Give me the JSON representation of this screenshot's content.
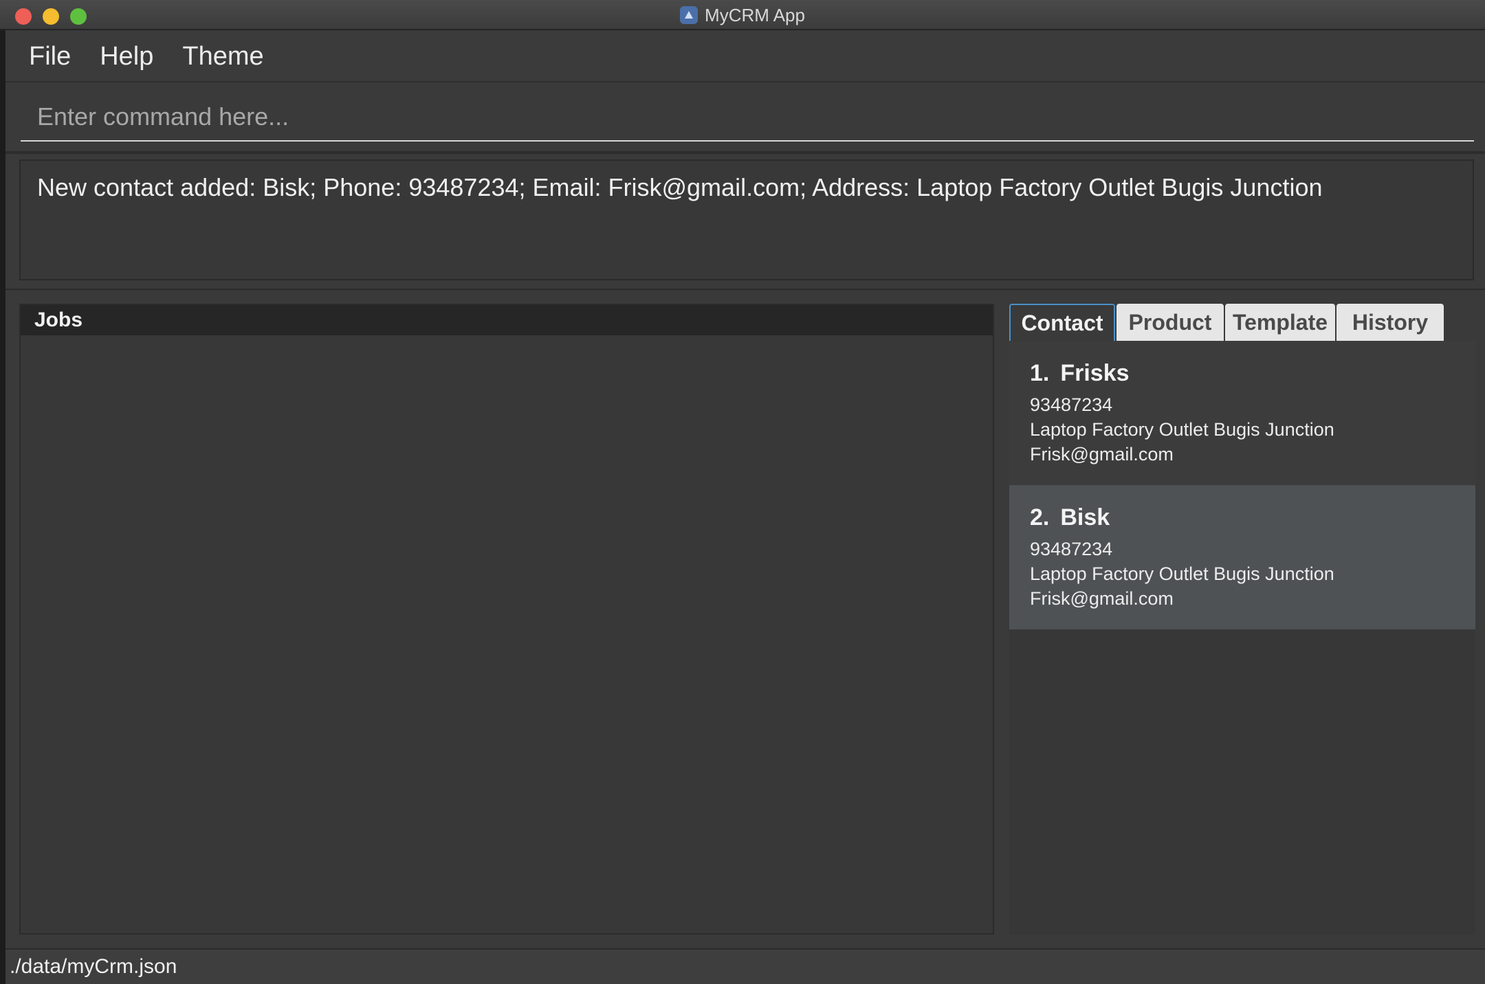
{
  "window": {
    "title": "MyCRM App",
    "icon": "app-logo-icon"
  },
  "menu": {
    "items": [
      "File",
      "Help",
      "Theme"
    ]
  },
  "command": {
    "placeholder": "Enter command here...",
    "value": ""
  },
  "result": {
    "message": "New contact added: Bisk; Phone: 93487234; Email: Frisk@gmail.com; Address: Laptop Factory Outlet Bugis Junction"
  },
  "jobs": {
    "header": "Jobs"
  },
  "tabs": [
    {
      "label": "Contact",
      "active": true
    },
    {
      "label": "Product",
      "active": false
    },
    {
      "label": "Template",
      "active": false
    },
    {
      "label": "History",
      "active": false
    }
  ],
  "contacts": [
    {
      "index": "1.",
      "name": "Frisks",
      "phone": "93487234",
      "address": "Laptop Factory Outlet Bugis Junction",
      "email": "Frisk@gmail.com"
    },
    {
      "index": "2.",
      "name": "Bisk",
      "phone": "93487234",
      "address": "Laptop Factory Outlet Bugis Junction",
      "email": "Frisk@gmail.com"
    }
  ],
  "status": {
    "path": "./data/myCrm.json"
  },
  "colors": {
    "background": "#3a3a3a",
    "active_tab_border": "#4a90c8",
    "selected_card": "#4e5254"
  }
}
